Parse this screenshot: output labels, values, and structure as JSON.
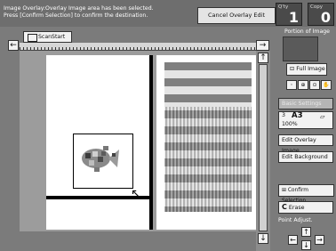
{
  "message": {
    "line1": "Image Overlay:Overlay Image area has been selected.",
    "line2": "Press [Confirm Selection] to confirm the destination."
  },
  "buttons": {
    "cancel_overlay_edit": "Cancel Overlay Edit",
    "scan_start": "ScanStart",
    "full_image": "Full Image",
    "basic_settings": "Basic Settings",
    "edit_overlay_image": "Edit Overlay Image",
    "edit_background": "Edit Background",
    "confirm_selection": "Confirm Selection",
    "erase_letter": "C",
    "erase": "Erase"
  },
  "counters": {
    "qty_label": "Q'ty",
    "qty_value": "1",
    "copy_label": "Copy",
    "copy_value": "0"
  },
  "panel": {
    "portion_label": "Portion of Image",
    "point_adjust_label": "Point Adjust."
  },
  "paper": {
    "tray": "3",
    "size": "A3",
    "ratio": "100%"
  },
  "icons": {
    "scan": "scan-start-icon",
    "left": "left-arrow-icon",
    "right_zero": "right-arrow-zero-icon",
    "up": "up-arrow-icon",
    "down": "down-arrow-icon",
    "full_image": "full-image-icon",
    "zoom": [
      "zoom-out-icon",
      "zoom-in-icon",
      "zoom-fit-icon",
      "hand-pan-icon"
    ],
    "paper": "paper-orientation-icon",
    "confirm": "confirm-selection-icon",
    "cursor": "pointer-cursor-icon"
  }
}
